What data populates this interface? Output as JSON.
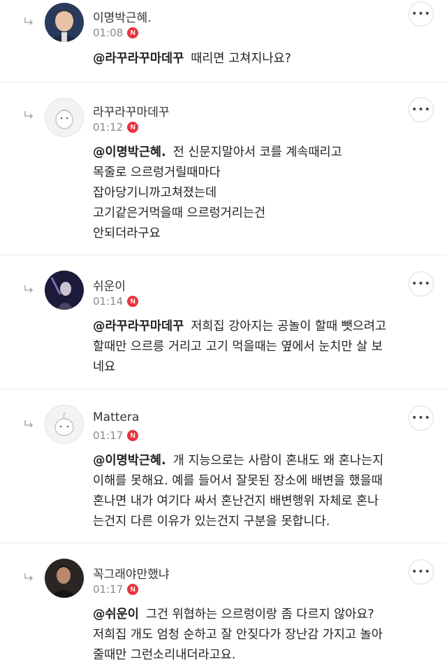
{
  "comments": [
    {
      "nickname": "이명박근혜.",
      "time": "01:08",
      "badge": "N",
      "mention": "@라꾸라꾸마데꾸",
      "lines": [
        "때리면 고쳐지나요?"
      ],
      "avatar": "person-photo"
    },
    {
      "nickname": "라꾸라꾸마데꾸",
      "time": "01:12",
      "badge": "N",
      "mention": "@이명박근혜.",
      "lines": [
        "전 신문지말아서 코를 계속때리고",
        "목줄로 으르렁거릴때마다",
        "잡아당기니까고쳐졌는데",
        "고기같은거먹을때 으르렁거리는건",
        "안되더라구요"
      ],
      "avatar": "default-character"
    },
    {
      "nickname": "쉬운이",
      "time": "01:14",
      "badge": "N",
      "mention": "@라꾸라꾸마데꾸",
      "lines": [
        "저희집 강아지는 공놀이 할때 뺏으려고",
        "할때만 으르릉 거리고 고기 먹을때는 옆에서 눈치만 살 보",
        "네요"
      ],
      "avatar": "dark-figure"
    },
    {
      "nickname": "Mattera",
      "time": "01:17",
      "badge": "N",
      "mention": "@이명박근혜.",
      "lines": [
        "개 지능으로는 사람이 혼내도 왜 혼나는지",
        "이해를 못해요. 예를 들어서 잘못된 장소에 배변을 했을때",
        "혼나면 내가 여기다 싸서 혼난건지 배변행위 자체로 혼나",
        "는건지 다른 이유가 있는건지 구분을 못합니다."
      ],
      "avatar": "default-character"
    },
    {
      "nickname": "꼭그래야만했냐",
      "time": "01:17",
      "badge": "N",
      "mention": "@쉬운이",
      "lines": [
        "그건 위협하는 으르렁이랑 좀 다르지 않아요?",
        "저희집 개도 엄청 순하고 잘 안짖다가 장난감 가지고 놀아",
        "줄때만 그런소리내더라고요."
      ],
      "avatar": "person-photo"
    }
  ],
  "more_label": "•••"
}
